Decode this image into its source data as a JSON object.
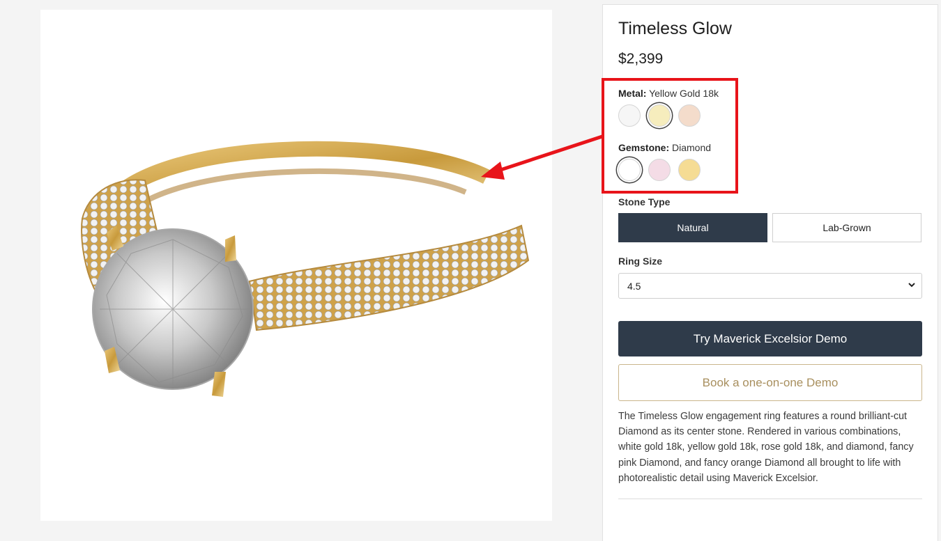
{
  "product": {
    "title": "Timeless Glow",
    "price": "$2,399"
  },
  "metal": {
    "label": "Metal:",
    "selected": "Yellow Gold 18k",
    "swatches": [
      {
        "name": "White Gold 18k",
        "color": "#f6f6f6"
      },
      {
        "name": "Yellow Gold 18k",
        "color": "#f6edbd"
      },
      {
        "name": "Rose Gold 18k",
        "color": "#f4dccb"
      }
    ]
  },
  "gemstone": {
    "label": "Gemstone:",
    "selected": "Diamond",
    "swatches": [
      {
        "name": "Diamond",
        "color": "#ffffff"
      },
      {
        "name": "Fancy Pink Diamond",
        "color": "#f4dce6"
      },
      {
        "name": "Fancy Orange Diamond",
        "color": "#f5dc94"
      }
    ]
  },
  "stone_type": {
    "label": "Stone Type",
    "options": [
      "Natural",
      "Lab-Grown"
    ],
    "selected": "Natural"
  },
  "ring_size": {
    "label": "Ring Size",
    "value": "4.5"
  },
  "actions": {
    "primary": "Try Maverick Excelsior Demo",
    "secondary": "Book a one-on-one Demo"
  },
  "description": "The Timeless Glow engagement ring features a round brilliant-cut Diamond as its center stone. Rendered in various combinations, white gold 18k, yellow gold 18k, rose gold 18k, and diamond, fancy pink Diamond, and fancy orange Diamond all brought to life with photorealistic detail using Maverick Excelsior.",
  "colors": {
    "accent_dark": "#2f3b4a",
    "highlight_red": "#e8141a",
    "secondary_text": "#a88f5e"
  }
}
